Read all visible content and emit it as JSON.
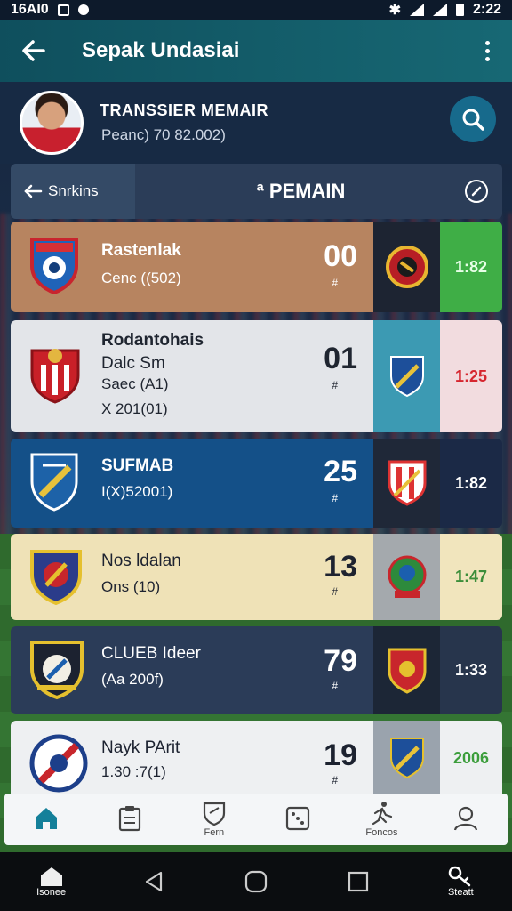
{
  "status_bar": {
    "time_left": "16AI0",
    "time_right": "2:22"
  },
  "app_bar": {
    "title": "Sepak Undasiai",
    "back_icon": "arrow-left-icon",
    "menu_icon": "more-vert-icon"
  },
  "profile": {
    "title": "TRANSSIER MEMAIR",
    "subtitle": "Peanc) 70 82.002)"
  },
  "tab_bar": {
    "back_label": "Snrkins",
    "title": "ª PEMAIN"
  },
  "rows": [
    {
      "name": "Rastenlak",
      "line2": "",
      "sub": "Cenc ((502)",
      "sub2": "",
      "number": "00",
      "hash": "#",
      "time": "1:82",
      "colors": {
        "main": "#b78460",
        "opp": "#1d2432",
        "time": "#3fae46",
        "text": "#ffffff",
        "time_text": "#e8ffe8"
      }
    },
    {
      "name": "Rodantohais",
      "line2": "Dalc Sm",
      "sub": "Saec (A1)",
      "sub2": "X 201(01)",
      "number": "01",
      "hash": "#",
      "time": "1:25",
      "colors": {
        "main": "#e3e5e9",
        "opp": "#3c9ab3",
        "time": "#f2dcdf",
        "text": "#1f2530",
        "time_text": "#d6262f"
      }
    },
    {
      "name": "SUFMAB",
      "line2": "",
      "sub": "I(X)52001)",
      "sub2": "",
      "number": "25",
      "hash": "#",
      "time": "1:82",
      "colors": {
        "main": "#145088",
        "opp": "#1f2838",
        "time": "#1b2946",
        "text": "#ffffff",
        "time_text": "#ffffff"
      }
    },
    {
      "name": "Nos ldalan",
      "line2": "",
      "sub": "Ons (10)",
      "sub2": "",
      "number": "13",
      "hash": "#",
      "time": "1:47",
      "colors": {
        "main": "#efe2b7",
        "opp": "#a4a9ad",
        "time": "#f1e5bd",
        "text": "#1e2330",
        "time_text": "#3c8e3a"
      }
    },
    {
      "name": "CLUEB Ideer",
      "line2": "",
      "sub": "(Aa 200f)",
      "sub2": "",
      "number": "79",
      "hash": "#",
      "time": "1:33",
      "colors": {
        "main": "#2b3c58",
        "opp": "#1c2636",
        "time": "#27354c",
        "text": "#ffffff",
        "time_text": "#ffffff"
      }
    },
    {
      "name": "Nayk PArit",
      "line2": "",
      "sub": "1.30 :7(1)",
      "sub2": "",
      "number": "19",
      "hash": "#",
      "time": "2006",
      "colors": {
        "main": "#eef0f2",
        "opp": "#9aa3ad",
        "time": "#eef0f2",
        "text": "#1c2230",
        "time_text": "#3c9e3c"
      }
    }
  ],
  "bottom_nav": [
    {
      "icon": "home-icon",
      "label": ""
    },
    {
      "icon": "clipboard-icon",
      "label": ""
    },
    {
      "icon": "shield-icon",
      "label": "Fern"
    },
    {
      "icon": "dice-icon",
      "label": ""
    },
    {
      "icon": "runner-icon",
      "label": "Foncos"
    },
    {
      "icon": "user-icon",
      "label": ""
    }
  ],
  "system_nav": {
    "home_label": "Isonee",
    "key_label": "Steatt"
  }
}
